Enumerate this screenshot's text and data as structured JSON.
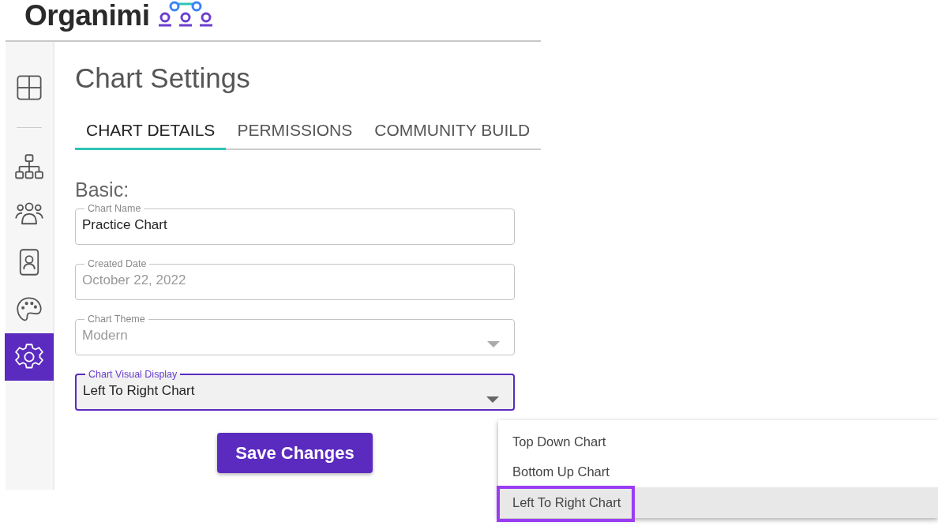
{
  "logo": {
    "text": "Organimi"
  },
  "sidebar": {
    "items": [
      {
        "kind": "dashboard",
        "selected": false
      },
      {
        "kind": "divider"
      },
      {
        "kind": "org-chart",
        "selected": false
      },
      {
        "kind": "people",
        "selected": false
      },
      {
        "kind": "contact",
        "selected": false
      },
      {
        "kind": "palette",
        "selected": false
      },
      {
        "kind": "settings",
        "selected": true
      }
    ]
  },
  "page_title": "Chart Settings",
  "tabs": [
    {
      "label": "CHART DETAILS",
      "selected": true
    },
    {
      "label": "PERMISSIONS",
      "selected": false
    },
    {
      "label": "COMMUNITY BUILD",
      "selected": false
    }
  ],
  "section_title": "Basic:",
  "fields": [
    {
      "kind": "text",
      "label": "Chart Name",
      "value": "Practice Chart",
      "disabled": false,
      "focused": false
    },
    {
      "kind": "text",
      "label": "Created Date",
      "value": "October 22, 2022",
      "disabled": true,
      "focused": false
    },
    {
      "kind": "select",
      "label": "Chart Theme",
      "value": "Modern",
      "disabled": true,
      "focused": false
    },
    {
      "kind": "select",
      "label": "Chart Visual Display",
      "value": "Left To Right Chart",
      "disabled": false,
      "focused": true
    }
  ],
  "save_button": "Save Changes",
  "dropdown_menu": {
    "options": [
      {
        "label": "Top Down Chart",
        "selected": false,
        "outlined": false
      },
      {
        "label": "Bottom Up Chart",
        "selected": false,
        "outlined": false
      },
      {
        "label": "Left To Right Chart",
        "selected": true,
        "outlined": true
      }
    ]
  }
}
